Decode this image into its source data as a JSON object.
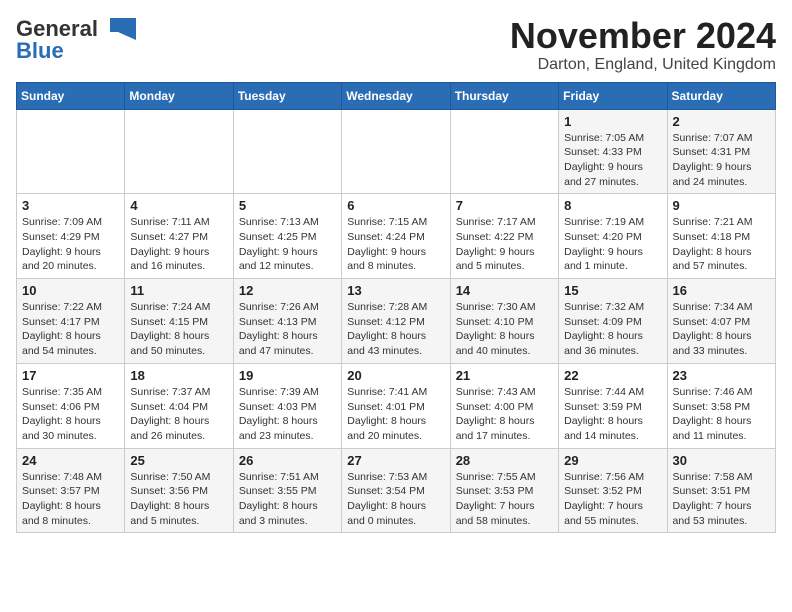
{
  "logo": {
    "general": "General",
    "blue": "Blue"
  },
  "title": "November 2024",
  "location": "Darton, England, United Kingdom",
  "days_header": [
    "Sunday",
    "Monday",
    "Tuesday",
    "Wednesday",
    "Thursday",
    "Friday",
    "Saturday"
  ],
  "weeks": [
    [
      {
        "day": "",
        "info": ""
      },
      {
        "day": "",
        "info": ""
      },
      {
        "day": "",
        "info": ""
      },
      {
        "day": "",
        "info": ""
      },
      {
        "day": "",
        "info": ""
      },
      {
        "day": "1",
        "info": "Sunrise: 7:05 AM\nSunset: 4:33 PM\nDaylight: 9 hours and 27 minutes."
      },
      {
        "day": "2",
        "info": "Sunrise: 7:07 AM\nSunset: 4:31 PM\nDaylight: 9 hours and 24 minutes."
      }
    ],
    [
      {
        "day": "3",
        "info": "Sunrise: 7:09 AM\nSunset: 4:29 PM\nDaylight: 9 hours and 20 minutes."
      },
      {
        "day": "4",
        "info": "Sunrise: 7:11 AM\nSunset: 4:27 PM\nDaylight: 9 hours and 16 minutes."
      },
      {
        "day": "5",
        "info": "Sunrise: 7:13 AM\nSunset: 4:25 PM\nDaylight: 9 hours and 12 minutes."
      },
      {
        "day": "6",
        "info": "Sunrise: 7:15 AM\nSunset: 4:24 PM\nDaylight: 9 hours and 8 minutes."
      },
      {
        "day": "7",
        "info": "Sunrise: 7:17 AM\nSunset: 4:22 PM\nDaylight: 9 hours and 5 minutes."
      },
      {
        "day": "8",
        "info": "Sunrise: 7:19 AM\nSunset: 4:20 PM\nDaylight: 9 hours and 1 minute."
      },
      {
        "day": "9",
        "info": "Sunrise: 7:21 AM\nSunset: 4:18 PM\nDaylight: 8 hours and 57 minutes."
      }
    ],
    [
      {
        "day": "10",
        "info": "Sunrise: 7:22 AM\nSunset: 4:17 PM\nDaylight: 8 hours and 54 minutes."
      },
      {
        "day": "11",
        "info": "Sunrise: 7:24 AM\nSunset: 4:15 PM\nDaylight: 8 hours and 50 minutes."
      },
      {
        "day": "12",
        "info": "Sunrise: 7:26 AM\nSunset: 4:13 PM\nDaylight: 8 hours and 47 minutes."
      },
      {
        "day": "13",
        "info": "Sunrise: 7:28 AM\nSunset: 4:12 PM\nDaylight: 8 hours and 43 minutes."
      },
      {
        "day": "14",
        "info": "Sunrise: 7:30 AM\nSunset: 4:10 PM\nDaylight: 8 hours and 40 minutes."
      },
      {
        "day": "15",
        "info": "Sunrise: 7:32 AM\nSunset: 4:09 PM\nDaylight: 8 hours and 36 minutes."
      },
      {
        "day": "16",
        "info": "Sunrise: 7:34 AM\nSunset: 4:07 PM\nDaylight: 8 hours and 33 minutes."
      }
    ],
    [
      {
        "day": "17",
        "info": "Sunrise: 7:35 AM\nSunset: 4:06 PM\nDaylight: 8 hours and 30 minutes."
      },
      {
        "day": "18",
        "info": "Sunrise: 7:37 AM\nSunset: 4:04 PM\nDaylight: 8 hours and 26 minutes."
      },
      {
        "day": "19",
        "info": "Sunrise: 7:39 AM\nSunset: 4:03 PM\nDaylight: 8 hours and 23 minutes."
      },
      {
        "day": "20",
        "info": "Sunrise: 7:41 AM\nSunset: 4:01 PM\nDaylight: 8 hours and 20 minutes."
      },
      {
        "day": "21",
        "info": "Sunrise: 7:43 AM\nSunset: 4:00 PM\nDaylight: 8 hours and 17 minutes."
      },
      {
        "day": "22",
        "info": "Sunrise: 7:44 AM\nSunset: 3:59 PM\nDaylight: 8 hours and 14 minutes."
      },
      {
        "day": "23",
        "info": "Sunrise: 7:46 AM\nSunset: 3:58 PM\nDaylight: 8 hours and 11 minutes."
      }
    ],
    [
      {
        "day": "24",
        "info": "Sunrise: 7:48 AM\nSunset: 3:57 PM\nDaylight: 8 hours and 8 minutes."
      },
      {
        "day": "25",
        "info": "Sunrise: 7:50 AM\nSunset: 3:56 PM\nDaylight: 8 hours and 5 minutes."
      },
      {
        "day": "26",
        "info": "Sunrise: 7:51 AM\nSunset: 3:55 PM\nDaylight: 8 hours and 3 minutes."
      },
      {
        "day": "27",
        "info": "Sunrise: 7:53 AM\nSunset: 3:54 PM\nDaylight: 8 hours and 0 minutes."
      },
      {
        "day": "28",
        "info": "Sunrise: 7:55 AM\nSunset: 3:53 PM\nDaylight: 7 hours and 58 minutes."
      },
      {
        "day": "29",
        "info": "Sunrise: 7:56 AM\nSunset: 3:52 PM\nDaylight: 7 hours and 55 minutes."
      },
      {
        "day": "30",
        "info": "Sunrise: 7:58 AM\nSunset: 3:51 PM\nDaylight: 7 hours and 53 minutes."
      }
    ]
  ]
}
